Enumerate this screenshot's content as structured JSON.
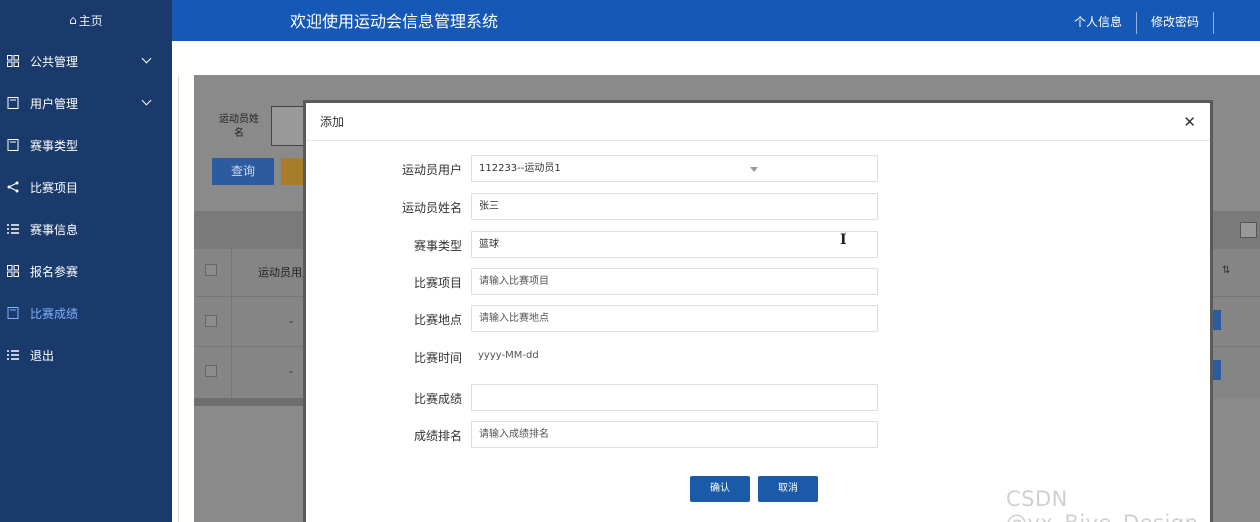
{
  "sidebar": {
    "home_label": "主页",
    "items": [
      {
        "label": "公共管理",
        "icon": "grid-icon",
        "expandable": true
      },
      {
        "label": "用户管理",
        "icon": "document-icon",
        "expandable": true
      },
      {
        "label": "赛事类型",
        "icon": "document-icon",
        "expandable": false
      },
      {
        "label": "比赛项目",
        "icon": "share-icon",
        "expandable": false
      },
      {
        "label": "赛事信息",
        "icon": "list-icon",
        "expandable": false
      },
      {
        "label": "报名参赛",
        "icon": "grid-icon",
        "expandable": false
      },
      {
        "label": "比赛成绩",
        "icon": "document-icon",
        "expandable": false,
        "active": true
      },
      {
        "label": "退出",
        "icon": "list-icon",
        "expandable": false
      }
    ]
  },
  "header": {
    "title": "欢迎使用运动会信息管理系统",
    "personal_info": "个人信息",
    "change_password": "修改密码"
  },
  "background": {
    "search_label": "运动员姓名",
    "query_button": "查询",
    "column_header": "运动员用户",
    "row_placeholder": "-"
  },
  "modal": {
    "title": "添加",
    "fields": {
      "athlete_user": {
        "label": "运动员用户",
        "value": "112233--运动员1"
      },
      "athlete_name": {
        "label": "运动员姓名",
        "value": "张三"
      },
      "event_type": {
        "label": "赛事类型",
        "value": "篮球"
      },
      "competition_item": {
        "label": "比赛项目",
        "placeholder": "请输入比赛项目"
      },
      "competition_location": {
        "label": "比赛地点",
        "placeholder": "请输入比赛地点"
      },
      "competition_time": {
        "label": "比赛时间",
        "placeholder": "yyyy-MM-dd"
      },
      "score": {
        "label": "比赛成绩",
        "value": ""
      },
      "ranking": {
        "label": "成绩排名",
        "placeholder": "请输入成绩排名"
      }
    },
    "confirm_button": "确认",
    "cancel_button": "取消"
  },
  "watermark": "CSDN @vx_Biye_Design",
  "colors": {
    "sidebar_bg": "#1a3a6b",
    "header_bg": "#1658b6",
    "primary_button": "#1a5aa8",
    "active_menu": "#7fb2ff"
  }
}
